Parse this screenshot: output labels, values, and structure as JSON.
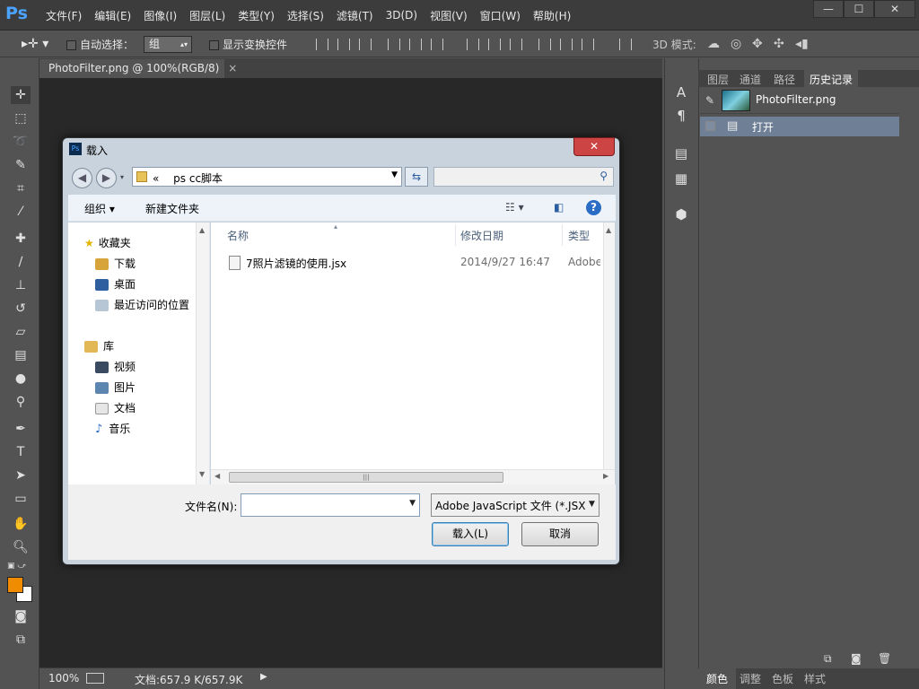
{
  "app": {
    "logo": "Ps",
    "menus": [
      "文件(F)",
      "编辑(E)",
      "图像(I)",
      "图层(L)",
      "类型(Y)",
      "选择(S)",
      "滤镜(T)",
      "3D(D)",
      "视图(V)",
      "窗口(W)",
      "帮助(H)"
    ],
    "window_buttons": [
      "—",
      "☐",
      "✕"
    ]
  },
  "options": {
    "auto_select_label": "自动选择：",
    "auto_select_value": "组",
    "show_transform_label": "显示变换控件",
    "mode_3d_label": "3D 模式:"
  },
  "document": {
    "tab_label": "PhotoFilter.png @ 100%(RGB/8)",
    "tab_close": "×",
    "zoom": "100%",
    "doc_info": "文档:657.9 K/657.9K"
  },
  "panel": {
    "tabs": [
      "图层",
      "通道",
      "路径",
      "历史记录"
    ],
    "snapshot_name": "PhotoFilter.png",
    "history_items": [
      "打开"
    ],
    "bottom_tabs": [
      "颜色",
      "调整",
      "色板",
      "样式"
    ]
  },
  "colors": {
    "foreground": "#f08c00",
    "background": "#ffffff",
    "accent": "#6f7f96"
  },
  "dialog": {
    "title": "载入",
    "address": [
      "«",
      "ps cc脚本"
    ],
    "commands": {
      "organize": "组织 ▾",
      "new_folder": "新建文件夹"
    },
    "nav": {
      "favorites": "收藏夹",
      "favorites_items": [
        "下载",
        "桌面",
        "最近访问的位置"
      ],
      "library": "库",
      "library_items": [
        "视频",
        "图片",
        "文档",
        "音乐"
      ]
    },
    "columns": [
      "名称",
      "修改日期",
      "类型"
    ],
    "files": [
      {
        "name": "7照片滤镜的使用.jsx",
        "date": "2014/9/27 16:47",
        "type": "Adobe"
      }
    ],
    "filename_label": "文件名(N):",
    "filename_value": "",
    "filetype_value": "Adobe JavaScript 文件 (*.JSX",
    "ok_label": "载入(L)",
    "cancel_label": "取消"
  }
}
